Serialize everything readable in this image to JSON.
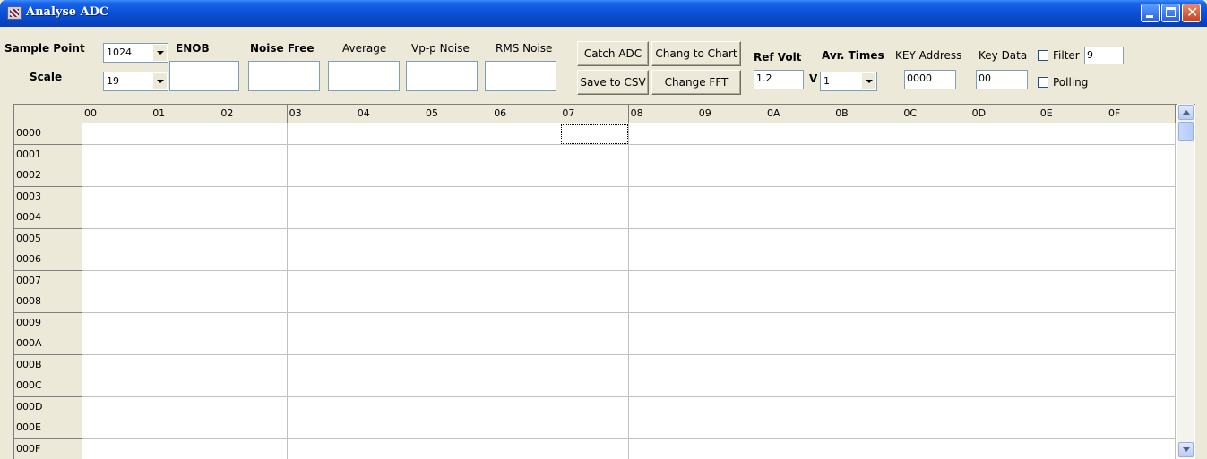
{
  "window": {
    "title": "Analyse ADC"
  },
  "controls": {
    "sample_point_label": "Sample Point",
    "sample_point_value": "1024",
    "scale_label": "Scale",
    "scale_value": "19",
    "enob_label": "ENOB",
    "enob_value": "",
    "noise_free_label": "Noise Free",
    "noise_free_value": "",
    "average_label": "Average",
    "average_value": "",
    "vpp_noise_label": "Vp-p Noise",
    "vpp_noise_value": "",
    "rms_noise_label": "RMS Noise",
    "rms_noise_value": "",
    "catch_adc": "Catch ADC",
    "chang_to_chart": "Chang to Chart",
    "save_to_csv": "Save to CSV",
    "change_fft": "Change FFT",
    "ref_volt_label": "Ref Volt",
    "ref_volt_value": "1.2",
    "volt_unit": "V",
    "avr_times_label": "Avr. Times",
    "avr_times_value": "1",
    "key_address_label": "KEY Address",
    "key_address_value": "0000",
    "key_data_label": "Key Data",
    "key_data_value": "00",
    "filter_label": "Filter",
    "filter_value": "9",
    "polling_label": "Polling"
  },
  "grid": {
    "columns": [
      "00",
      "01",
      "02",
      "03",
      "04",
      "05",
      "06",
      "07",
      "08",
      "09",
      "0A",
      "0B",
      "0C",
      "0D",
      "0E",
      "0F"
    ],
    "rows": [
      "0000",
      "0001",
      "0002",
      "0003",
      "0004",
      "0005",
      "0006",
      "0007",
      "0008",
      "0009",
      "000A",
      "000B",
      "000C",
      "000D",
      "000E",
      "000F"
    ]
  }
}
